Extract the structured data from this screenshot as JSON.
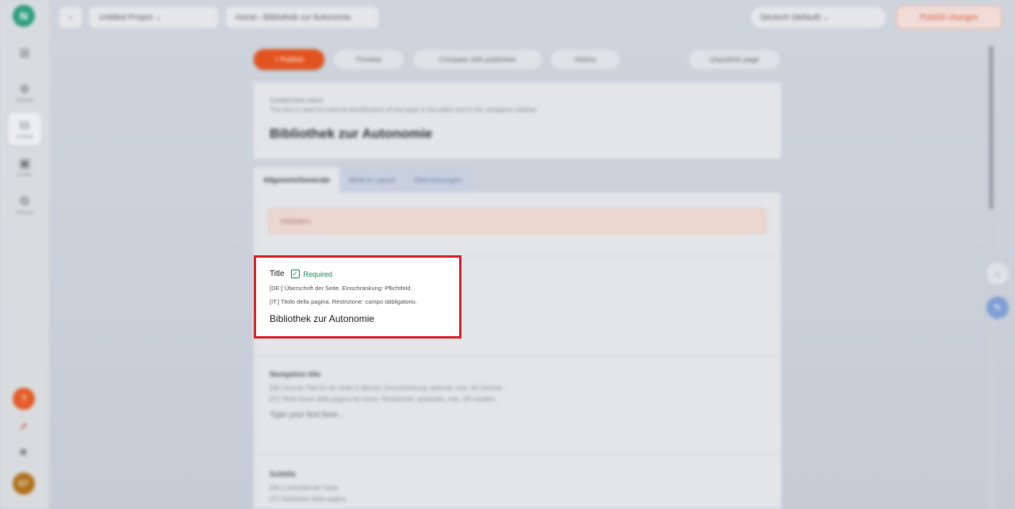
{
  "sidebar": {
    "logo_text": "N",
    "items": [
      {
        "label": "",
        "icon": "grid-icon"
      },
      {
        "label": "Settings",
        "icon": "globe-icon"
      },
      {
        "label": "Content",
        "icon": "stack-icon"
      },
      {
        "label": "Assets",
        "icon": "image-icon"
      },
      {
        "label": "Schema",
        "icon": "settings-icon"
      }
    ],
    "help_label": "?",
    "avatar_initials": "EF"
  },
  "topbar": {
    "back_label": "‹",
    "project_label": "Untitled Project ⌄",
    "breadcrumb": "Home › Bibliothek zur Autonomie",
    "locale_select": "Deutsch (default) ⌄",
    "publish_label": "Publish changes"
  },
  "toolbar": {
    "primary_label": "+ Publish",
    "actions": [
      "Preview",
      "Compare with published",
      "History"
    ],
    "right_label": "Unpublish page"
  },
  "page_header": {
    "label": "Content item name",
    "description": "This text is used for internal identification of this page in the editor and in the navigation sidebar.",
    "title": "Bibliothek zur Autonomie"
  },
  "tabs": [
    "Allgemein/Generale",
    "Meta & Layout",
    "Übersetzungen"
  ],
  "validation": {
    "text": "Validation"
  },
  "fields": {
    "title": {
      "label": "Title",
      "required": "Required",
      "desc_de": "[DE:] Überschrift der Seite. Einschränkung: Pflichtfeld.",
      "desc_it": "[IT:] Titolo della pagina. Restrizione: campo obbligatorio.",
      "value": "Bibliothek zur Autonomie"
    },
    "navigation": {
      "label": "Navigation title",
      "desc_de": "[DE:] Kurzer Titel für die Seite in Menüs. Einschränkung: optional, max. 40 Zeichen.",
      "desc_it": "[IT:] Titolo breve della pagina nei menu. Restrizione: opzionale, max. 40 caratteri.",
      "placeholder": "Type your text here..."
    },
    "subtitle": {
      "label": "Subtitle",
      "desc_de": "[DE:] Untertitel der Seite.",
      "desc_it": "[IT:] Sottotitolo della pagina."
    }
  },
  "colors": {
    "accent": "#e2541f",
    "required": "#1b8a5a",
    "highlight": "#d9262e"
  }
}
